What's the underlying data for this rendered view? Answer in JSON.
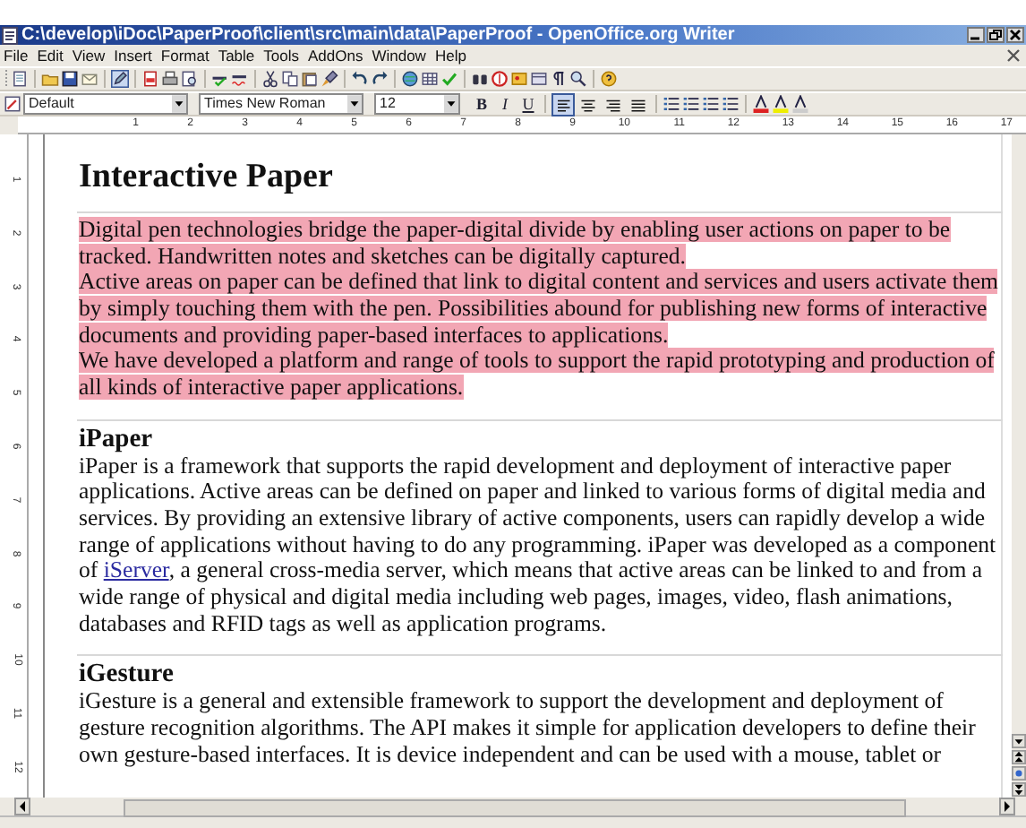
{
  "window": {
    "title": "C:\\develop\\iDoc\\PaperProof\\client\\src\\main\\data\\PaperProof - OpenOffice.org Writer"
  },
  "menu": [
    {
      "label": "File"
    },
    {
      "label": "Edit"
    },
    {
      "label": "View"
    },
    {
      "label": "Insert"
    },
    {
      "label": "Format"
    },
    {
      "label": "Table"
    },
    {
      "label": "Tools"
    },
    {
      "label": "AddOns"
    },
    {
      "label": "Window"
    },
    {
      "label": "Help"
    }
  ],
  "format_bar": {
    "paragraph_style": "Default",
    "font_name": "Times New Roman",
    "font_size": "12",
    "styles": [
      {
        "label": "B",
        "kind": "bold",
        "selected": false
      },
      {
        "label": "I",
        "kind": "italic",
        "selected": false
      },
      {
        "label": "U",
        "kind": "underline",
        "selected": false
      }
    ],
    "alignments": [
      {
        "kind": "left",
        "selected": true
      },
      {
        "kind": "center",
        "selected": false
      },
      {
        "kind": "right",
        "selected": false
      },
      {
        "kind": "justify",
        "selected": false
      }
    ]
  },
  "ruler": {
    "marks": [
      "1",
      "2",
      "3",
      "4",
      "5",
      "6",
      "7",
      "8",
      "9",
      "10",
      "11",
      "12",
      "13",
      "14",
      "15",
      "16",
      "17"
    ]
  },
  "vertical_ruler": {
    "marks": [
      "1",
      "2",
      "3",
      "4",
      "5",
      "6",
      "7",
      "8",
      "9",
      "10",
      "11",
      "12"
    ]
  },
  "document": {
    "blocks": [
      {
        "kind": "title",
        "text": "Interactive Paper"
      },
      {
        "kind": "rule"
      },
      {
        "kind": "paragraph",
        "highlighted": true,
        "segments": [
          {
            "text": "Digital pen technologies bridge the paper-digital divide by enabling user actions on paper to be tracked. Handwritten notes and sketches can be digitally captured."
          }
        ]
      },
      {
        "kind": "paragraph",
        "highlighted": true,
        "segments": [
          {
            "text": "Active areas on paper can be defined that link to digital content and services and users activate them by simply touching them with the pen. Possibilities abound for publishing new forms of interactive documents and providing paper-based interfaces to applications."
          }
        ]
      },
      {
        "kind": "paragraph",
        "highlighted": true,
        "segments": [
          {
            "text": "We have developed a platform and range of tools to support the rapid prototyping and production of all kinds of interactive paper applications."
          }
        ]
      },
      {
        "kind": "rule"
      },
      {
        "kind": "heading",
        "text": "iPaper"
      },
      {
        "kind": "paragraph",
        "highlighted": false,
        "segments": [
          {
            "text": "iPaper is a framework that supports the rapid development and deployment of interactive paper applications. Active areas can be defined on paper and linked to various forms of digital media and services. By providing an extensive library of active components, users can rapidly develop a wide range of applications without having to do any programming. iPaper was developed as a component of "
          },
          {
            "text": "iServer",
            "kind": "link"
          },
          {
            "text": ", a general cross-media server, which means that active areas can be linked to and from a wide range of physical and digital media including web pages, images, video, flash animations, databases and RFID tags as well as application programs."
          }
        ]
      },
      {
        "kind": "rule"
      },
      {
        "kind": "heading",
        "text": "iGesture"
      },
      {
        "kind": "paragraph",
        "highlighted": false,
        "segments": [
          {
            "text": "iGesture is a general and extensible framework to support the development and deployment of gesture recognition algorithms. The API makes it simple for application developers to define their own gesture-based interfaces. It is device independent and can be used with a mouse, tablet or"
          }
        ]
      }
    ]
  }
}
